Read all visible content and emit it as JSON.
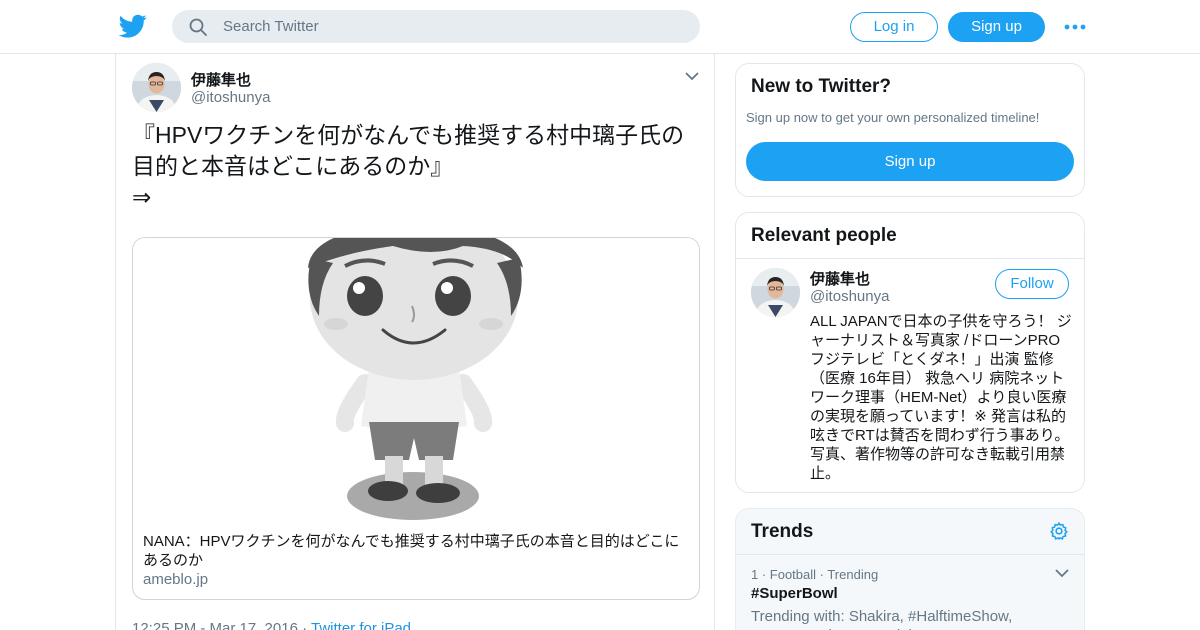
{
  "header": {
    "search_placeholder": "Search Twitter",
    "login_label": "Log in",
    "signup_label": "Sign up",
    "brand_color": "#1da1f2"
  },
  "tweet": {
    "author_name": "伊藤隼也",
    "author_handle": "@itoshunya",
    "text": "『HPVワクチンを何がなんでも推奨する村中璃子氏の目的と本音はどこにあるのか』\n⇒",
    "card": {
      "title": "NANA：HPVワクチンを何がなんでも推奨する村中璃子氏の本音と目的はどこにあるのか",
      "domain": "ameblo.jp"
    },
    "timestamp": "12:25 PM - Mar 17, 2016 · ",
    "source": "Twitter for iPad"
  },
  "sidebar": {
    "new_to_twitter": {
      "title": "New to Twitter?",
      "subtitle": "Sign up now to get your own personalized timeline!",
      "button": "Sign up"
    },
    "relevant_people": {
      "title": "Relevant people",
      "person": {
        "name": "伊藤隼也",
        "handle": "@itoshunya",
        "follow_label": "Follow",
        "bio": "ALL JAPANで日本の子供を守ろう！ ジャーナリスト＆写真家 /ドローンPRO フジテレビ「とくダネ！」出演 監修（医療 16年目） 救急ヘリ 病院ネットワーク理事（HEM-Net）より良い医療の実現を願っています！※ 発言は私的呟きでRTは賛否を問わず行う事あり。写真、著作物等の許可なき転載引用禁止。"
      }
    },
    "trends": {
      "title": "Trends",
      "items": [
        {
          "meta": "1 · Football · Trending",
          "name": "#SuperBowl",
          "trending_with": "Trending with: Shakira, #HalftimeShow, #SuperBowlCommercials"
        }
      ]
    }
  }
}
